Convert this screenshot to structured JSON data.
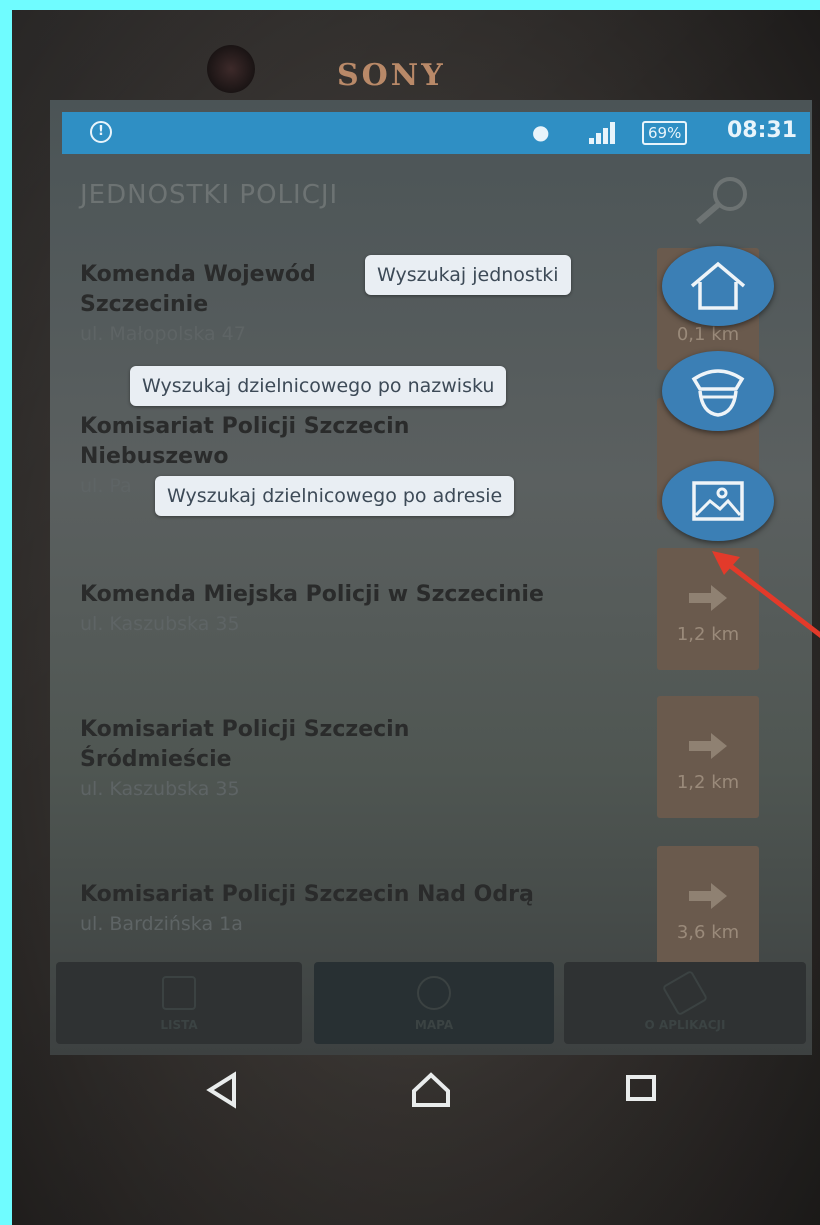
{
  "device": {
    "brand": "SONY"
  },
  "status_bar": {
    "battery": "69%",
    "time": "08:31"
  },
  "app_bar": {
    "title": "JEDNOSTKI POLICJI"
  },
  "list": [
    {
      "title": "Komenda Wojewód",
      "title2": "Szczecinie",
      "address": "ul. Małopolska 47",
      "distance": "0,1 km"
    },
    {
      "title": "Komisariat Policji Szczecin",
      "title2": "Niebuszewo",
      "address": "ul. Pa",
      "distance": ""
    },
    {
      "title": "Komenda Miejska Policji w Szczecinie",
      "title2": "",
      "address": "ul. Kaszubska 35",
      "distance": "1,2 km"
    },
    {
      "title": "Komisariat Policji Szczecin",
      "title2": "Śródmieście",
      "address": "ul. Kaszubska 35",
      "distance": "1,2 km"
    },
    {
      "title": "Komisariat Policji Szczecin Nad Odrą",
      "title2": "",
      "address": "ul. Bardzińska 1a",
      "distance": "3,6 km"
    }
  ],
  "fab_menu": [
    {
      "label": "Wyszukaj jednostki",
      "icon": "home-icon"
    },
    {
      "label": "Wyszukaj dzielnicowego po nazwisku",
      "icon": "police-cap-icon"
    },
    {
      "label": "Wyszukaj dzielnicowego po adresie",
      "icon": "image-icon"
    }
  ],
  "bottom_nav": [
    {
      "label": "LISTA",
      "icon": "list-icon"
    },
    {
      "label": "MAPA",
      "icon": "map-pin-icon"
    },
    {
      "label": "O APLIKACJI",
      "icon": "megaphone-icon"
    }
  ],
  "system_nav": [
    "back-icon",
    "home-icon",
    "recents-icon"
  ],
  "colors": {
    "frame": "#6ffcff",
    "status_bar": "#2f8fc4",
    "fab": "#3b7fb5",
    "tooltip_bg": "#e9eef3",
    "arrow_annotation": "#e33a2a"
  }
}
